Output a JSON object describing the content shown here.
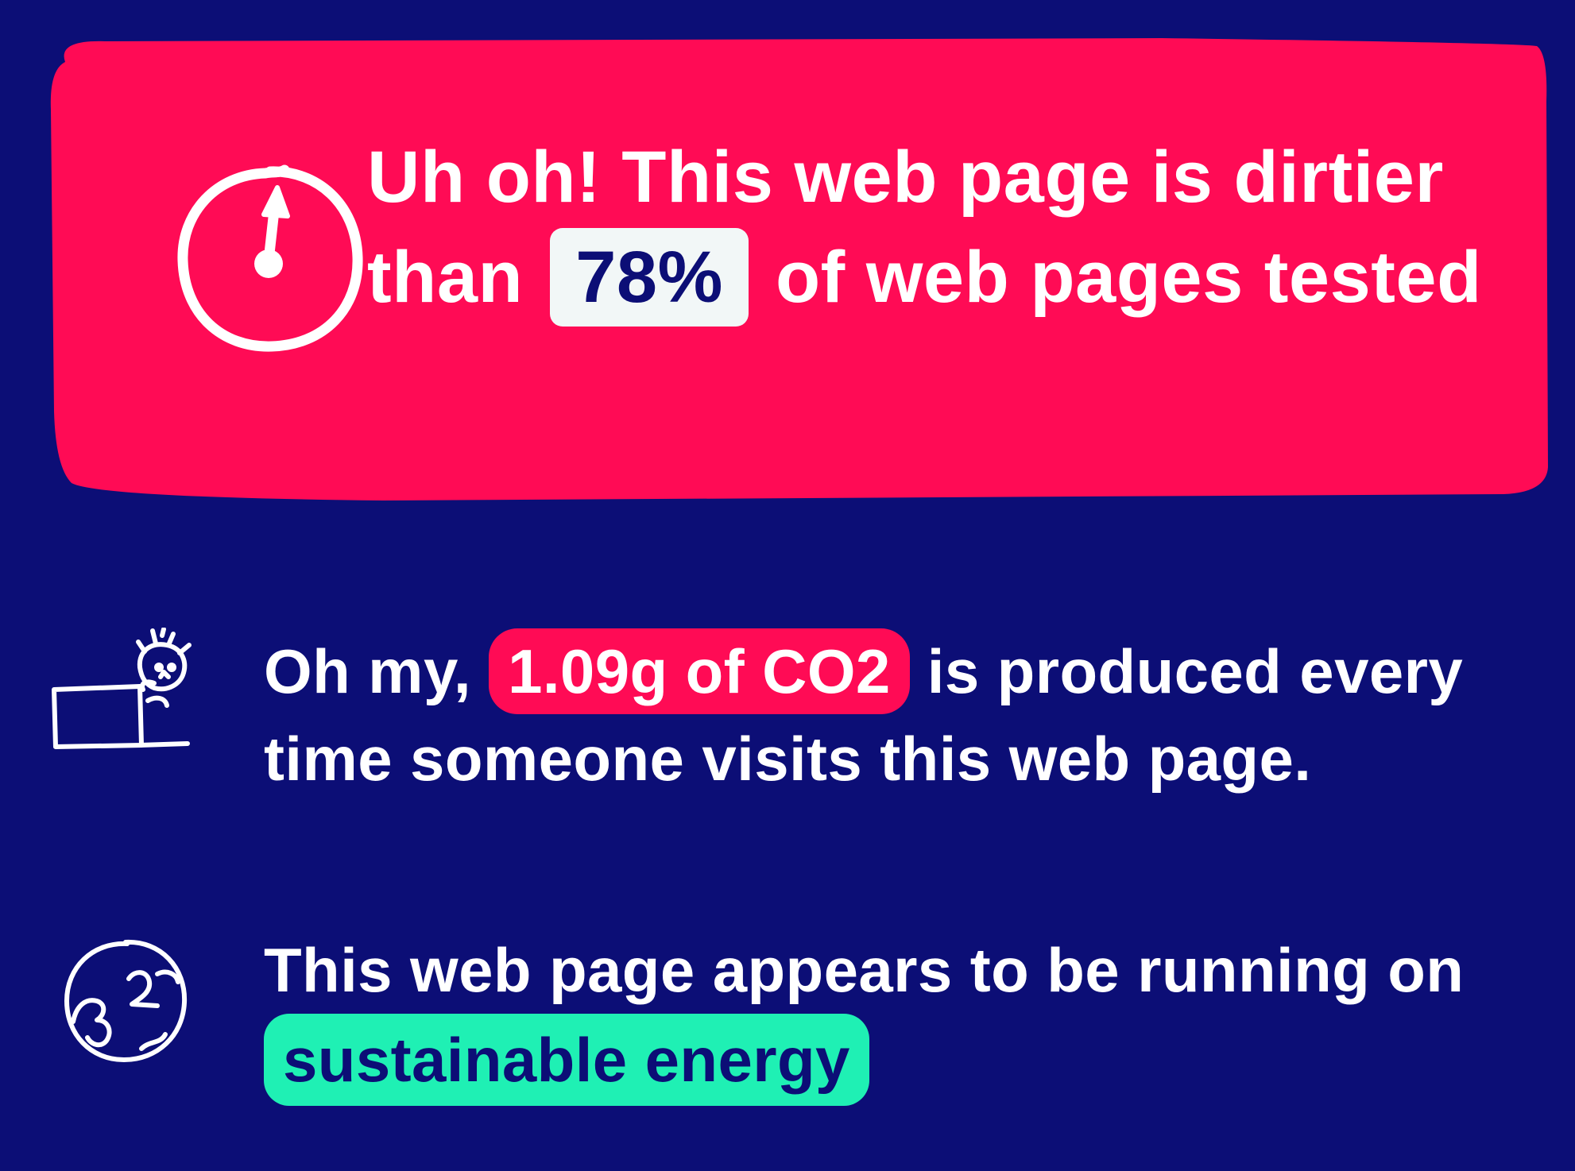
{
  "colors": {
    "background": "#0c0e76",
    "card": "#ff0b55",
    "pill_light": "#f2f7f7",
    "accent_green": "#1ff0b4",
    "text": "#ffffff"
  },
  "result_card": {
    "icon": "gauge-icon",
    "headline_before": "Uh oh! This web page is dirtier than ",
    "percent": "78%",
    "headline_after": " of web pages tested"
  },
  "co2_row": {
    "icon": "laptop-person-icon",
    "text_before": "Oh my, ",
    "highlight": "1.09g of CO2",
    "text_after": " is produced every time someone visits this web page."
  },
  "energy_row": {
    "icon": "globe-icon",
    "text_before": "This web page appears to be running on ",
    "highlight": "sustainable energy"
  }
}
